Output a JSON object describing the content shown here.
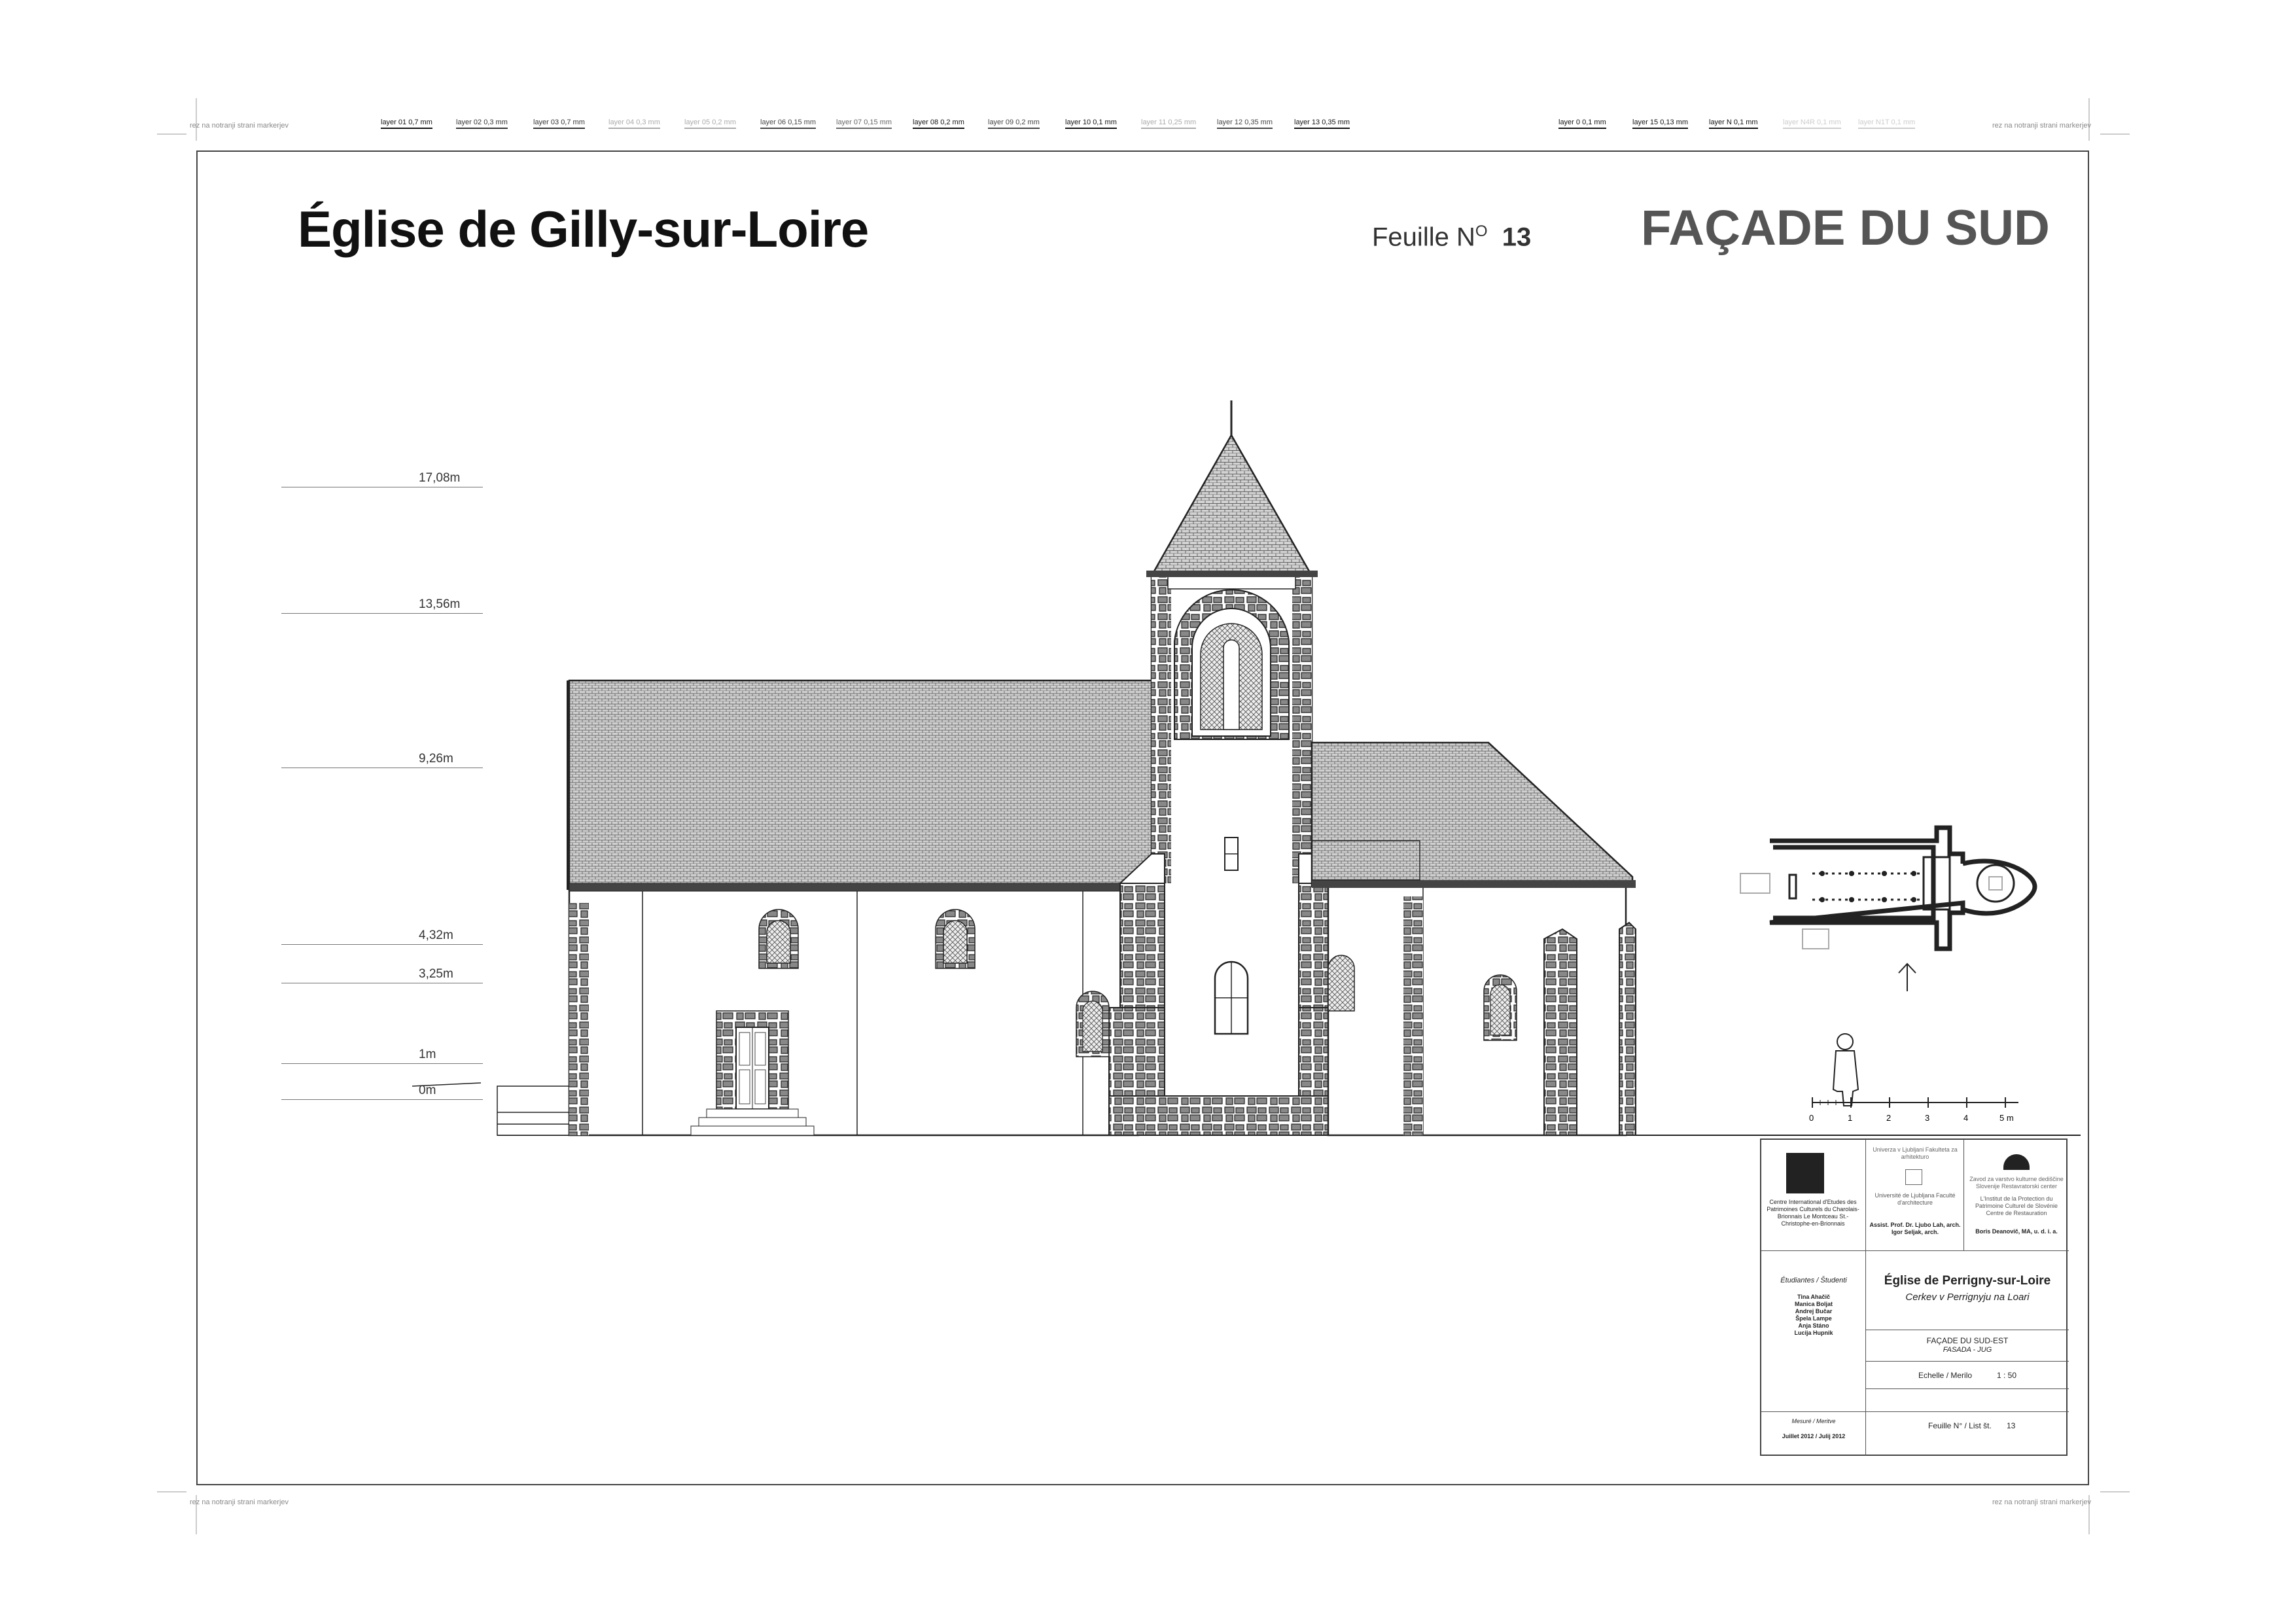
{
  "margin_notes": {
    "top_left": "rez na notranji strani markerjev",
    "top_right": "rez na notranji strani markerjev",
    "bottom_left": "rez na notranji strani markerjev",
    "bottom_right": "rez na notranji strani markerjev"
  },
  "layers": [
    {
      "label": "layer 01 0,7 mm",
      "tone": "#111"
    },
    {
      "label": "layer 02 0,3 mm",
      "tone": "#333"
    },
    {
      "label": "layer 03 0,7 mm",
      "tone": "#333"
    },
    {
      "label": "layer 04 0,3 mm",
      "tone": "#aaa"
    },
    {
      "label": "layer 05 0,2 mm",
      "tone": "#aaa"
    },
    {
      "label": "layer 06 0,15 mm",
      "tone": "#444"
    },
    {
      "label": "layer 07 0,15 mm",
      "tone": "#666"
    },
    {
      "label": "layer 08 0,2 mm",
      "tone": "#111"
    },
    {
      "label": "layer 09 0,2 mm",
      "tone": "#444"
    },
    {
      "label": "layer 10 0,1 mm",
      "tone": "#111"
    },
    {
      "label": "layer 11 0,25 mm",
      "tone": "#aaa"
    },
    {
      "label": "layer 12 0,35 mm",
      "tone": "#444"
    },
    {
      "label": "layer 13 0,35 mm",
      "tone": "#111"
    },
    {
      "label": "layer 0 0,1 mm",
      "tone": "#111"
    },
    {
      "label": "layer 15 0,13 mm",
      "tone": "#111"
    },
    {
      "label": "layer N 0,1 mm",
      "tone": "#111"
    },
    {
      "label": "layer N4R 0,1 mm",
      "tone": "#ccc"
    },
    {
      "label": "layer N1T 0,1 mm",
      "tone": "#ccc"
    }
  ],
  "header": {
    "title": "Église de Gilly-sur-Loire",
    "sheet_label": "Feuille N",
    "sheet_sup": "O",
    "sheet_number": "13",
    "facade_title": "FAÇADE DU SUD"
  },
  "levels": [
    {
      "label": "17,08m",
      "value": 17.08
    },
    {
      "label": "13,56m",
      "value": 13.56
    },
    {
      "label": "9,26m",
      "value": 9.26
    },
    {
      "label": "4,32m",
      "value": 4.32
    },
    {
      "label": "3,25m",
      "value": 3.25
    },
    {
      "label": "1m",
      "value": 1
    },
    {
      "label": "0m",
      "value": 0
    }
  ],
  "scale_bar": [
    "0",
    "1",
    "2",
    "3",
    "4",
    "5 m"
  ],
  "cartouche": {
    "org1": "Centre International d'Etudes des Patrimoines Culturels du Charolais-Brionnais Le Montceau St.-Christophe-en-Brionnais",
    "org2_head": "Univerza v Ljubljani Fakulteta za arhitekturo",
    "org2": "Université de Ljubljana Faculté d'architecture",
    "org2_people": "Assist. Prof. Dr. Ljubo Lah, arch. Igor Seljak, arch.",
    "org3_head": "Zavod za varstvo kulturne dediščine Slovenije Restavratorski center",
    "org3": "L'Institut de la Protection du Patrimoine Culturel de Slovénie Centre de Restauration",
    "org3_people": "Boris Deanovič, MA, u. d. i. a.",
    "students_label": "Étudiantes / Študenti",
    "students": [
      "Tina Ahačič",
      "Manica Boljat",
      "Andrej Bučar",
      "Špela Lampe",
      "Anja Stáno",
      "Lucija Hupnik"
    ],
    "project_title": "Église de Perrigny-sur-Loire",
    "project_sub": "Cerkev v Perrignyju na Loari",
    "sheet_title": "FAÇADE DU SUD-EST",
    "sheet_title_sub": "FASADA - JUG",
    "scale_label": "Echelle / Merilo",
    "scale_value": "1 : 50",
    "survey_label": "Mesuré / Meritve",
    "survey_date": "Juillet 2012 / Julij 2012",
    "sheet_label": "Feuille N° / List št.",
    "sheet_number": "13"
  }
}
